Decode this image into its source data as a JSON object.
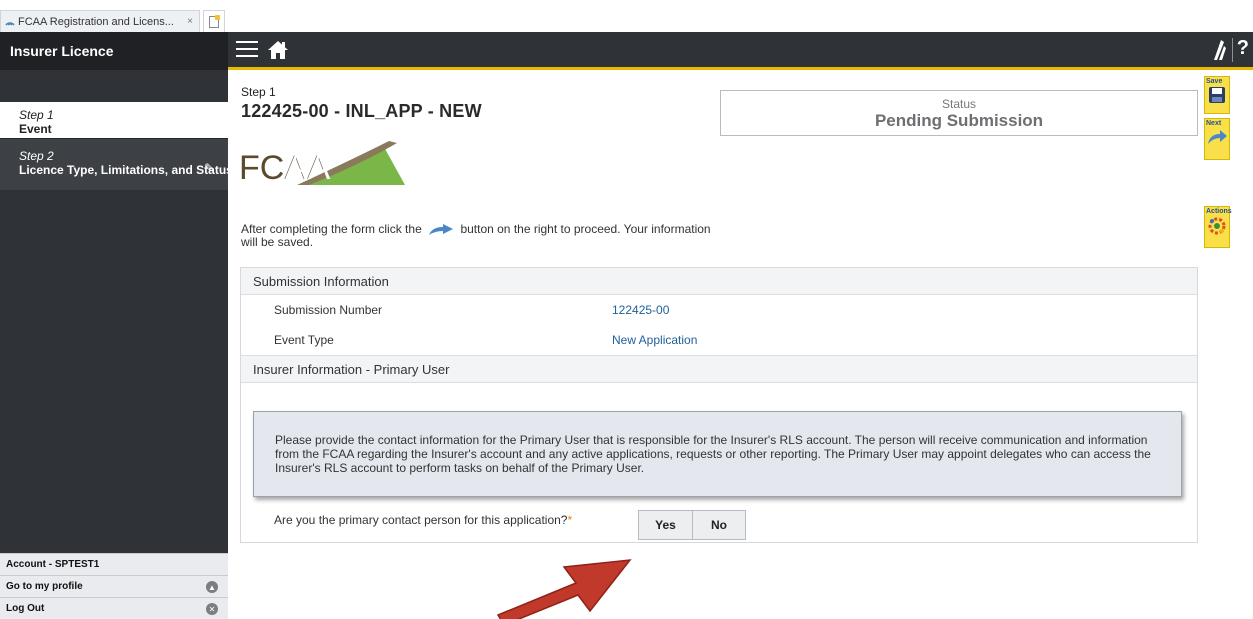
{
  "browser": {
    "tab_title": "FCAA Registration and Licens...",
    "tab_close": "×"
  },
  "sidebar": {
    "title": "Insurer Licence",
    "steps": [
      {
        "step": "Step 1",
        "name": "Event"
      },
      {
        "step": "Step 2",
        "name": "Licence Type, Limitations, and Status"
      }
    ],
    "account": "Account - SPTEST1",
    "profile_link": "Go to my profile",
    "logout": "Log Out"
  },
  "rail": {
    "save_label": "Save",
    "next_label": "Next",
    "actions_label": "Actions"
  },
  "header": {
    "help": "?"
  },
  "page": {
    "step_label": "Step 1",
    "title": "122425-00 - INL_APP - NEW",
    "status_label": "Status",
    "status_value": "Pending Submission",
    "logo_text": "FCAA",
    "instruction_before": "After completing the form click the",
    "instruction_after": "button on the right to proceed. Your information will be saved."
  },
  "submission": {
    "header": "Submission Information",
    "fields": [
      {
        "label": "Submission Number",
        "value": "122425-00"
      },
      {
        "label": "Event Type",
        "value": "New Application"
      }
    ]
  },
  "insurer": {
    "header": "Insurer Information - Primary User",
    "notice": "Please provide the contact information for the Primary User that is responsible for the Insurer's RLS account. The person will receive communication and information from the FCAA regarding the Insurer's account and any active applications, requests or other reporting. The Primary User may appoint delegates who can access the Insurer's RLS account to perform tasks on behalf of the Primary User.",
    "question": "Are you the primary contact person for this application?",
    "required_mark": "*",
    "yes_label": "Yes",
    "no_label": "No"
  },
  "colors": {
    "accent": "#e9b800",
    "sidebar_bg": "#2f3237",
    "link": "#22609b",
    "annotation_arrow": "#c0392b"
  }
}
